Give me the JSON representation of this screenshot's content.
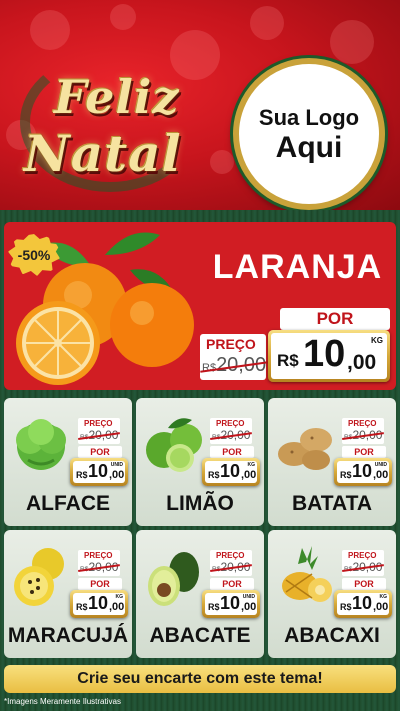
{
  "header": {
    "headline_line1": "Feliz",
    "headline_line2": "Natal",
    "logo_line1": "Sua Logo",
    "logo_line2": "Aqui"
  },
  "hero": {
    "discount": "-50%",
    "name": "LARANJA",
    "preco_label": "PREÇO",
    "old_currency": "R$",
    "old_price": "20,00",
    "por_label": "POR",
    "currency": "R$",
    "price_int": "10",
    "price_dec": ",00",
    "unit": "KG",
    "icon": "orange-icon"
  },
  "products": [
    {
      "name": "ALFACE",
      "preco_label": "PREÇO",
      "old_currency": "R$",
      "old_price": "20,00",
      "por_label": "POR",
      "currency": "R$",
      "price_int": "10",
      "price_dec": ",00",
      "unit": "UNID",
      "icon": "lettuce-icon"
    },
    {
      "name": "LIMÃO",
      "preco_label": "PREÇO",
      "old_currency": "R$",
      "old_price": "20,00",
      "por_label": "POR",
      "currency": "R$",
      "price_int": "10",
      "price_dec": ",00",
      "unit": "KG",
      "icon": "lime-icon"
    },
    {
      "name": "BATATA",
      "preco_label": "PREÇO",
      "old_currency": "R$",
      "old_price": "20,00",
      "por_label": "POR",
      "currency": "R$",
      "price_int": "10",
      "price_dec": ",00",
      "unit": "UNID",
      "icon": "potato-icon"
    },
    {
      "name": "MARACUJÁ",
      "preco_label": "PREÇO",
      "old_currency": "R$",
      "old_price": "20,00",
      "por_label": "POR",
      "currency": "R$",
      "price_int": "10",
      "price_dec": ",00",
      "unit": "KG",
      "icon": "passion-fruit-icon"
    },
    {
      "name": "ABACATE",
      "preco_label": "PREÇO",
      "old_currency": "R$",
      "old_price": "20,00",
      "por_label": "POR",
      "currency": "R$",
      "price_int": "10",
      "price_dec": ",00",
      "unit": "UNID",
      "icon": "avocado-icon"
    },
    {
      "name": "ABACAXI",
      "preco_label": "PREÇO",
      "old_currency": "R$",
      "old_price": "20,00",
      "por_label": "POR",
      "currency": "R$",
      "price_int": "10",
      "price_dec": ",00",
      "unit": "KG",
      "icon": "pineapple-icon"
    }
  ],
  "footer": {
    "cta": "Crie seu encarte com este tema!",
    "disclaimer": "*Imagens Meramente Ilustrativas"
  },
  "colors": {
    "header_red": "#d11d23",
    "gold": "#d6a93a",
    "price_red": "#c0141b",
    "background_green": "#1f4d2d"
  }
}
